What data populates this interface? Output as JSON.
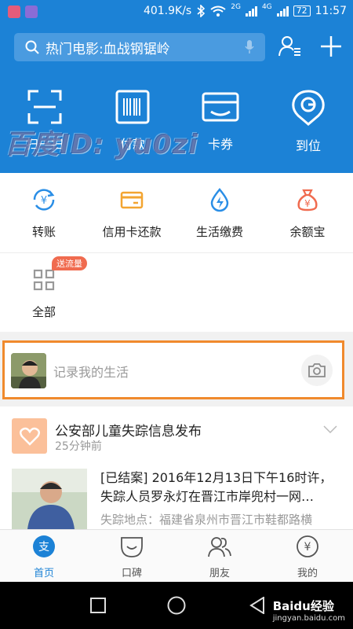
{
  "status_bar": {
    "speed": "401.9K/s",
    "net_2g": "2G",
    "net_4g": "4G",
    "battery": "72",
    "time": "11:57"
  },
  "header": {
    "search_text": "热门电影:血战钢锯岭",
    "quick_actions": [
      {
        "label": "扫一扫",
        "icon": "scan-icon"
      },
      {
        "label": "付款",
        "icon": "barcode-icon"
      },
      {
        "label": "卡券",
        "icon": "wallet-icon"
      },
      {
        "label": "到位",
        "icon": "location-icon"
      }
    ]
  },
  "watermark": "百度ID: yu0zi",
  "grid": {
    "items": [
      {
        "label": "转账",
        "icon": "transfer-icon",
        "color": "#2a8ee6"
      },
      {
        "label": "信用卡还款",
        "icon": "credit-card-icon",
        "color": "#f3a531"
      },
      {
        "label": "生活缴费",
        "icon": "utility-icon",
        "color": "#2a8ee6"
      },
      {
        "label": "余额宝",
        "icon": "money-bag-icon",
        "color": "#f06b4f"
      },
      {
        "label": "全部",
        "icon": "all-apps-icon",
        "color": "#999999"
      }
    ],
    "badge": "送流量"
  },
  "record": {
    "placeholder": "记录我的生活"
  },
  "card": {
    "title": "公安部儿童失踪信息发布",
    "time": "25分钟前",
    "body": "[已结案] 2016年12月13日下午16时许，失踪人员罗永灯在晋江市岸兜村一网…",
    "location": "失踪地点：福建省泉州市晋江市鞋都路横"
  },
  "tabbar": {
    "tabs": [
      {
        "label": "首页",
        "icon": "home-tab-icon"
      },
      {
        "label": "口碑",
        "icon": "koubei-tab-icon"
      },
      {
        "label": "朋友",
        "icon": "friends-tab-icon"
      },
      {
        "label": "我的",
        "icon": "mine-tab-icon"
      }
    ]
  },
  "baidu_watermark": {
    "brand": "Baidu经验",
    "url": "jingyan.baidu.com"
  },
  "colors": {
    "primary": "#1c82d6",
    "accent_orange": "#f08a2d",
    "badge_red": "#f06b4f"
  }
}
